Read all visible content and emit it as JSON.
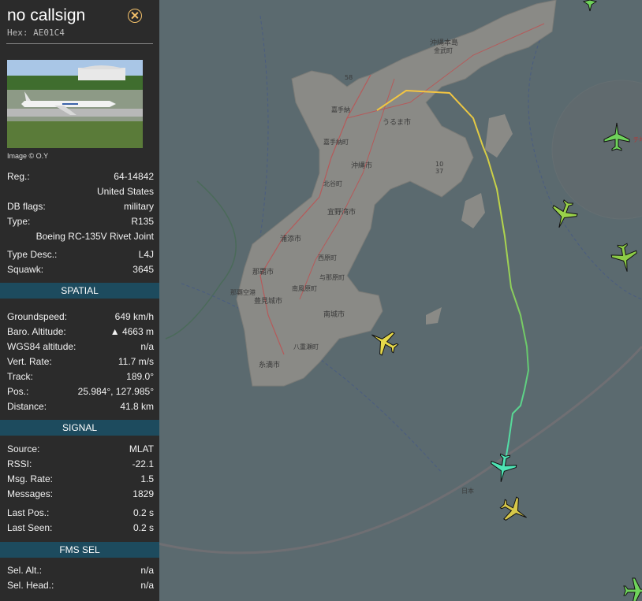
{
  "aircraft": {
    "callsign": "no callsign",
    "hex": "Hex: AE01C4",
    "image_credit": "Image © O.Y"
  },
  "details": [
    {
      "label": "Reg.:",
      "value": "64-14842"
    },
    {
      "label": "",
      "value": "United States"
    },
    {
      "label": "DB flags:",
      "value": "military"
    },
    {
      "label": "Type:",
      "value": "R135"
    },
    {
      "label": "",
      "value": "Boeing RC-135V Rivet Joint"
    },
    {
      "label": "Type Desc.:",
      "value": "L4J"
    },
    {
      "label": "Squawk:",
      "value": "3645"
    }
  ],
  "spatial": {
    "title": "SPATIAL",
    "rows": [
      {
        "label": "Groundspeed:",
        "value": "649 km/h"
      },
      {
        "label": "Baro. Altitude:",
        "value": "▲ 4663 m"
      },
      {
        "label": "WGS84 altitude:",
        "value": "n/a"
      },
      {
        "label": "Vert. Rate:",
        "value": "11.7 m/s"
      },
      {
        "label": "Track:",
        "value": "189.0°"
      },
      {
        "label": "Pos.:",
        "value": "25.984°, 127.985°"
      },
      {
        "label": "Distance:",
        "value": "41.8 km"
      }
    ]
  },
  "signal": {
    "title": "SIGNAL",
    "rows": [
      {
        "label": "Source:",
        "value": "MLAT"
      },
      {
        "label": "RSSI:",
        "value": "-22.1"
      },
      {
        "label": "Msg. Rate:",
        "value": "1.5"
      },
      {
        "label": "Messages:",
        "value": "1829"
      },
      {
        "label": "Last Pos.:",
        "value": "0.2 s"
      },
      {
        "label": "Last Seen:",
        "value": "0.2 s"
      }
    ]
  },
  "fms": {
    "title": "FMS SEL",
    "rows": [
      {
        "label": "Sel. Alt.:",
        "value": "n/a"
      },
      {
        "label": "Sel. Head.:",
        "value": "n/a"
      }
    ]
  },
  "map_labels": {
    "okinawa_honto": "沖縄本島",
    "kin": "金武町",
    "uruma": "うるま市",
    "okinawa_city": "沖縄市",
    "kadena": "嘉手納町",
    "kadena_base": "嘉手納",
    "chatan": "北谷町",
    "ginowan": "宜野湾市",
    "urasoe": "浦添市",
    "nishihara": "西原町",
    "naha": "那覇市",
    "yonabaru": "与那原町",
    "haebaru": "南風原町",
    "tomigusuku": "豊見城市",
    "nanjo": "南城市",
    "yaese": "八重瀬町",
    "itoman": "糸満市",
    "naha_airport": "那覇空港",
    "route_58": "58",
    "route_10": "10",
    "route_37": "37",
    "area_label": "ト チ地 区",
    "fir_label": "日本"
  },
  "colors": {
    "sea": "#5b6a6f",
    "land": "#8a8a86",
    "panel": "#2b2b2b",
    "section": "#1d4b5e",
    "selected_aircraft": "#4ee3b4"
  },
  "icons": [
    "close-icon",
    "aircraft-photo",
    "aircraft-icon"
  ]
}
